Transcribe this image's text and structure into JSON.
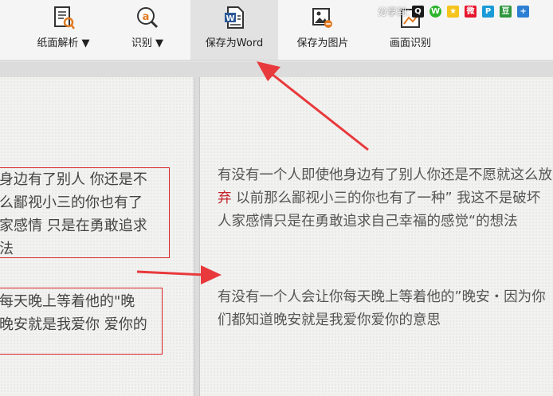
{
  "toolbar": {
    "items": [
      {
        "label": "纸面解析 ▼"
      },
      {
        "label": "识别 ▼"
      },
      {
        "label": "保存为Word"
      },
      {
        "label": "保存为图片"
      },
      {
        "label": "画面识别"
      }
    ]
  },
  "share": {
    "label": "分享到:",
    "icons": [
      "qq-icon",
      "wechat-icon",
      "qzone-icon",
      "weibo-icon",
      "tencent-weibo-icon",
      "douban-icon",
      "more-share-icon"
    ]
  },
  "left_pane": {
    "box1": [
      "身边有了别人 你还是不",
      "么鄙视小三的你也有了",
      "家感情 只是在勇敢追求",
      "法"
    ],
    "box2": [
      "每天晚上等着他的\"晚",
      "晚安就是我爱你 爱你的"
    ]
  },
  "right_pane": {
    "para1_a": "有没有一个人即使他身边有了别人你还是不愿就这么放",
    "para1_red": "弃",
    "para1_b": " 以前那么鄙视小三的你也有了一种” 我这不是破坏人家感情只是在勇敢追求自己幸福的感觉“的想法",
    "para2": " 有没有一个人会让你每天晚上等着他的”晚安・因为你们都知道晚安就是我爱你爱你的意思"
  },
  "colors": {
    "annotation_red": "#e8393c",
    "box_border": "#d9262b"
  }
}
